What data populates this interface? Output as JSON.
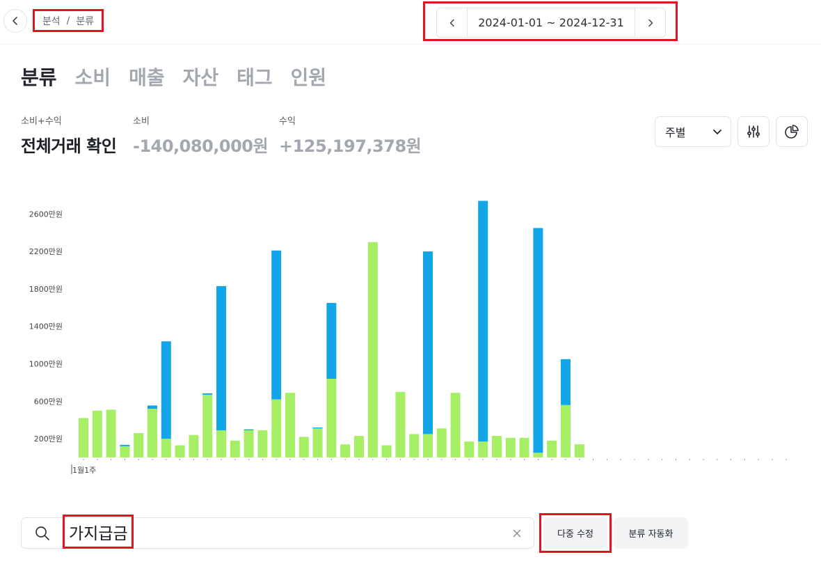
{
  "breadcrumb": {
    "parent": "분석",
    "separator": "/",
    "current": "분류"
  },
  "date_range": {
    "text": "2024-01-01 ~ 2024-12-31"
  },
  "tabs": [
    {
      "label": "분류",
      "active": true
    },
    {
      "label": "소비",
      "active": false
    },
    {
      "label": "매출",
      "active": false
    },
    {
      "label": "자산",
      "active": false
    },
    {
      "label": "태그",
      "active": false
    },
    {
      "label": "인원",
      "active": false
    }
  ],
  "summary": {
    "total": {
      "caption": "소비+수익",
      "value": "전체거래 확인"
    },
    "expense": {
      "caption": "소비",
      "value": "-140,080,000원"
    },
    "income": {
      "caption": "수익",
      "value": "+125,197,378원"
    }
  },
  "controls": {
    "period": "주별",
    "filter_icon": "sliders-icon",
    "chart_icon": "pie-chart-icon"
  },
  "search": {
    "value": "가지급금",
    "clear_icon": "close-icon"
  },
  "buttons": {
    "multi_edit": "다중 수정",
    "auto_classify": "분류 자동화"
  },
  "colors": {
    "green": "#a6ef64",
    "blue": "#12a5e8",
    "highlight": "#e0141e"
  },
  "chart_data": {
    "type": "bar",
    "stacked": true,
    "x_first_label": "1월1주",
    "categories_count": 52,
    "ytick_labels": [
      "200만원",
      "600만원",
      "1000만원",
      "1400만원",
      "1800만원",
      "2200만원",
      "2600만원"
    ],
    "ytick_values": [
      200,
      600,
      1000,
      1400,
      1800,
      2200,
      2600
    ],
    "ylim": [
      0,
      2800
    ],
    "unit": "만원",
    "series": [
      {
        "values": [
          420,
          500,
          510,
          120,
          260,
          520,
          200,
          130,
          240,
          670,
          290,
          180,
          290,
          290,
          620,
          690,
          220,
          310,
          840,
          140,
          230,
          2300,
          130,
          700,
          250,
          250,
          310,
          690,
          170,
          170,
          230,
          210,
          210,
          50,
          180,
          560,
          140
        ]
      },
      {
        "values": [
          0,
          0,
          0,
          15,
          0,
          35,
          1040,
          0,
          0,
          15,
          1540,
          0,
          10,
          0,
          1590,
          0,
          0,
          10,
          810,
          0,
          0,
          0,
          0,
          0,
          0,
          1950,
          0,
          0,
          0,
          2570,
          0,
          0,
          0,
          2400,
          0,
          490,
          0
        ]
      }
    ]
  }
}
